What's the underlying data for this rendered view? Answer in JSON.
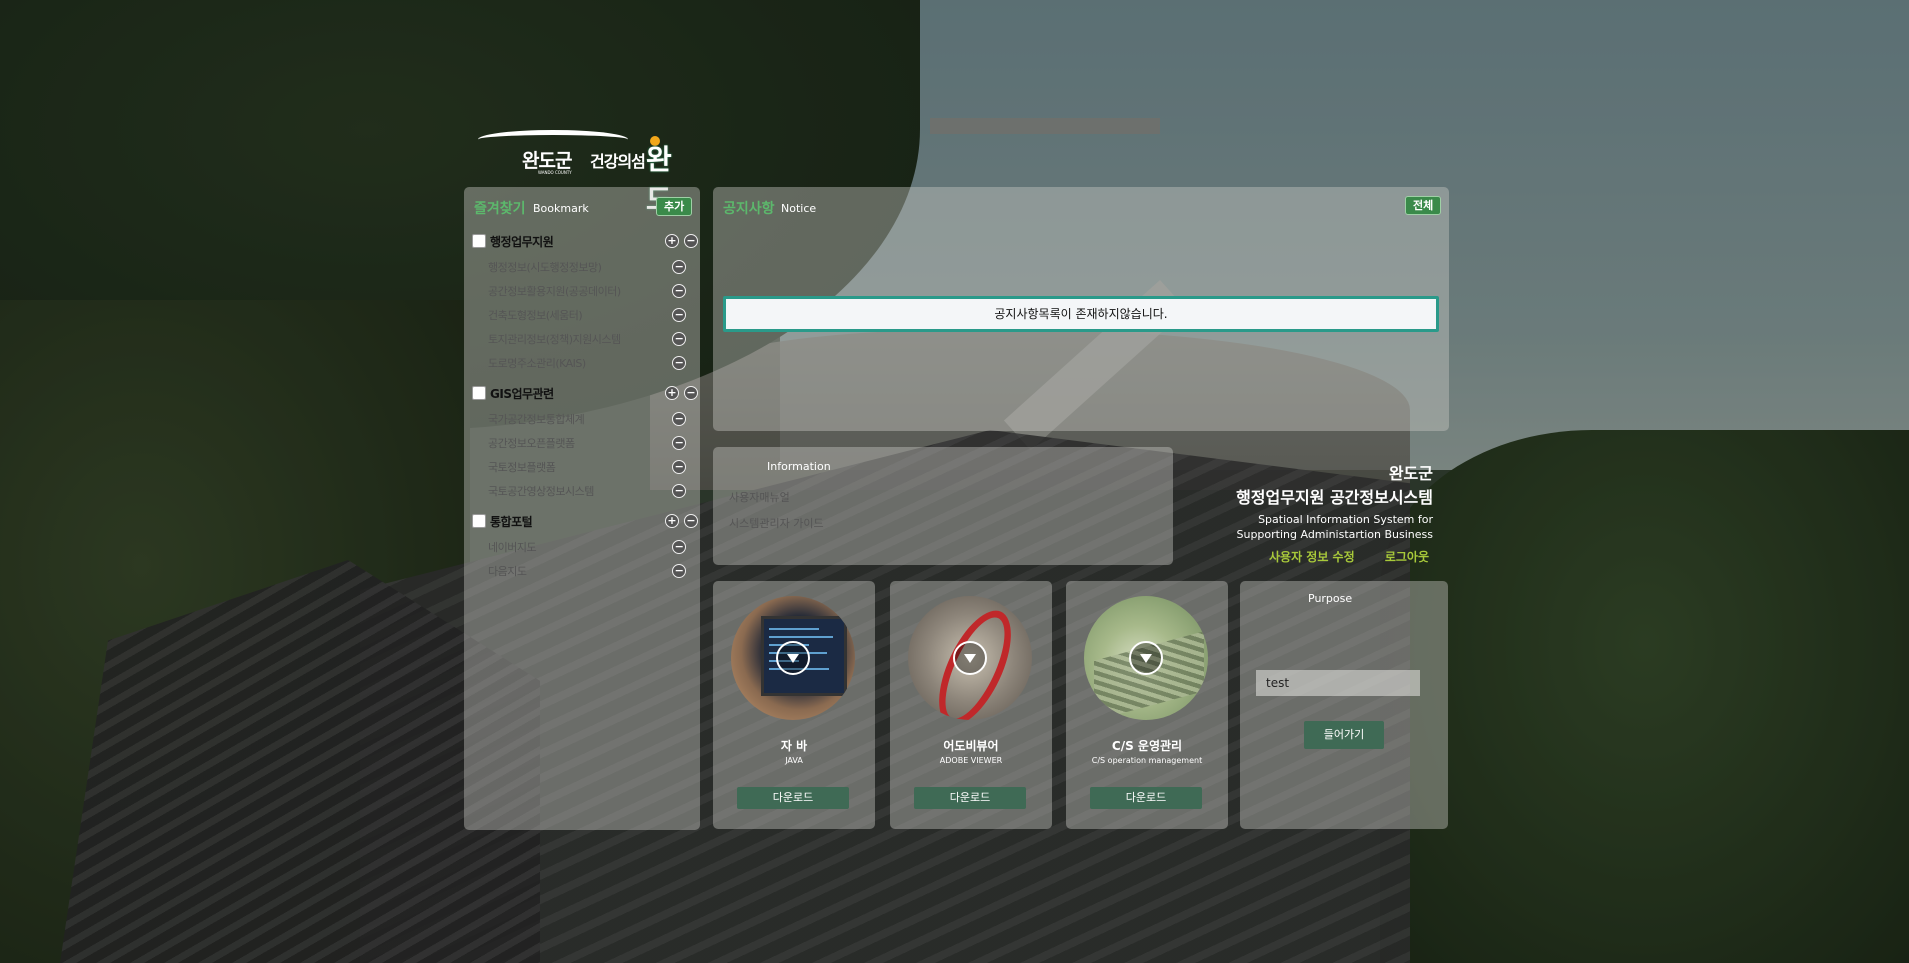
{
  "logo": {
    "name": "완도군",
    "county": "WANDO COUNTY",
    "slogan": "건강의섬",
    "slogan_big": "완도"
  },
  "bookmark": {
    "title": "즐겨찾기",
    "subtitle": "Bookmark",
    "add_label": "추가",
    "groups": [
      {
        "label": "행정업무지원",
        "items": [
          "행정정보(시도행정정보망)",
          "공간정보활용지원(공공데이터)",
          "건축도형정보(세움터)",
          "토지관리정보(정책)지원시스템",
          "도로명주소관리(KAIS)"
        ]
      },
      {
        "label": "GIS업무관련",
        "items": [
          "국가공간정보통합체계",
          "공간정보오픈플랫폼",
          "국토정보플랫폼",
          "국토공간영상정보시스템"
        ]
      },
      {
        "label": "통합포털",
        "items": [
          "네이버지도",
          "다음지도"
        ]
      }
    ]
  },
  "notice": {
    "title": "공지사항",
    "subtitle": "Notice",
    "all_label": "전체",
    "empty_message": "공지사항목록이 존재하지않습니다."
  },
  "info": {
    "subtitle": "Information",
    "items": [
      "사용자매뉴얼",
      "시스템관리자 가이드"
    ]
  },
  "system": {
    "org": "완도군",
    "name_kr": "행정업무지원 공간정보시스템",
    "name_en_1": "Spatioal Information System for",
    "name_en_2": "Supporting Administartion Business",
    "link_user_info": "사용자 정보 수정",
    "link_logout": "로그아웃"
  },
  "downloads": [
    {
      "title": "자 바",
      "subtitle": "JAVA",
      "button": "다운로드"
    },
    {
      "title": "어도비뷰어",
      "subtitle": "ADOBE VIEWER",
      "button": "다운로드"
    },
    {
      "title": "C/S 운영관리",
      "subtitle": "C/S operation management",
      "button": "다운로드"
    }
  ],
  "purpose": {
    "subtitle": "Purpose",
    "input_value": "test",
    "button": "들어가기"
  },
  "colors": {
    "accent_green": "#5cb86c",
    "button_green": "#3a8a4a",
    "notice_border": "#2a9a8a",
    "link_yellow": "#a8c93a",
    "download_button": "#3f6a55"
  }
}
